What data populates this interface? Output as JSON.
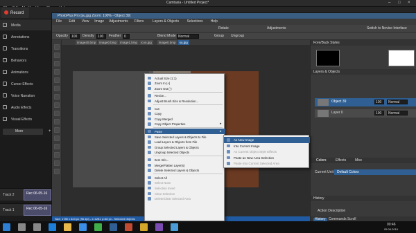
{
  "camtasia": {
    "menu": [
      "File",
      "Edit",
      "Modify",
      "View",
      "Share",
      "Help"
    ],
    "title": "Camtasia - Untitled Project*",
    "record_label": "Record",
    "sidebar": [
      {
        "label": "Media"
      },
      {
        "label": "Annotations"
      },
      {
        "label": "Transitions"
      },
      {
        "label": "Behaviors"
      },
      {
        "label": "Animations"
      },
      {
        "label": "Cursor Effects"
      },
      {
        "label": "Voice Narration"
      },
      {
        "label": "Audio Effects"
      },
      {
        "label": "Visual Effects"
      }
    ],
    "more_label": "More",
    "tracks": [
      {
        "label": "Track 2",
        "clip": "Rec 06-05-16"
      },
      {
        "label": "Track 1",
        "clip": "Rec 06-05-16"
      }
    ]
  },
  "ppp": {
    "title": "PhotoPlus Pro [su.jpg Zoom: 100% - Object 39]",
    "menu": [
      "File",
      "Edit",
      "View",
      "Image",
      "Adjustments",
      "Filters",
      "Layers & Objects",
      "Selections",
      "Help"
    ],
    "toolbar1": {
      "rotate": "Rotate",
      "adjustments": "Adjustments",
      "switch": "Switch to Novice Interface"
    },
    "toolbar2": {
      "opacity_label": "Opacity",
      "opacity": "100",
      "density_label": "Density",
      "density": "100",
      "feather_label": "Feather",
      "feather": "0",
      "blend_label": "Blend Mode",
      "blend": "Normal",
      "group": "Group",
      "ungroup": "Ungroup"
    },
    "tabs": [
      "image40.bmp",
      "image0.bmp",
      "image1.bmp",
      "icon.jpg",
      "image0.bmp",
      "su.jpg"
    ],
    "status": "Size: 1780 x 623 px (96 dpi) - x=1281 y=48 px - Selected Objects",
    "right": {
      "forebackstyles": "Fore/Back Styles",
      "layers": "Layers & Objects",
      "layer_rows": [
        {
          "name": "Object 39",
          "opacity": "100",
          "blend": "Normal"
        },
        {
          "name": "Layer 0",
          "opacity": "100",
          "blend": "Normal"
        }
      ],
      "tabs2": [
        "Colors",
        "Effects",
        "Misc"
      ],
      "current_unit_label": "Current Unit",
      "current_unit": "Default Colors",
      "history": "History",
      "action_description": "Action Description",
      "bottom_tabs": [
        "History",
        "Commands Scroll"
      ]
    }
  },
  "context_menu": [
    {
      "label": "Actual Size (1:1)"
    },
    {
      "label": "Zoom In (+)"
    },
    {
      "label": "Zoom Out (-)"
    },
    {
      "sep": true
    },
    {
      "label": "Resize..."
    },
    {
      "label": "Adjust Brush Size & Resolution..."
    },
    {
      "sep": true
    },
    {
      "label": "Cut"
    },
    {
      "label": "Copy"
    },
    {
      "label": "Copy Merged"
    },
    {
      "label": "Copy Object Properties"
    },
    {
      "sep": true
    },
    {
      "label": "Paste",
      "highlight": true
    },
    {
      "label": "Save Selected Layers & Objects to File"
    },
    {
      "label": "Load Layers & Objects from File"
    },
    {
      "label": "Group Selected Layers & Objects"
    },
    {
      "label": "Ungroup Selected Objects"
    },
    {
      "sep": true
    },
    {
      "label": "Item Info..."
    },
    {
      "label": "Merge/Flatten Layer(s)"
    },
    {
      "label": "Delete Selected Layers & Objects"
    },
    {
      "sep": true
    },
    {
      "label": "Select All"
    },
    {
      "label": "Select None",
      "disabled": true
    },
    {
      "label": "Selection Invert",
      "disabled": true
    },
    {
      "label": "Clear Selection",
      "disabled": true
    },
    {
      "label": "Delete/Clear Selected Area",
      "disabled": true
    }
  ],
  "paste_submenu": [
    {
      "label": "As New Image",
      "highlight": true
    },
    {
      "label": "Into Current Image"
    },
    {
      "label": "As Current Object Style Effects",
      "disabled": true
    },
    {
      "label": "Paste as New Area Selection"
    },
    {
      "label": "Paste Into Current Selected Area",
      "disabled": true
    }
  ],
  "taskbar": {
    "time": "00:46",
    "date": "05.06.2016"
  },
  "colors": {
    "accent": "#2f5f93",
    "record": "#e03b2f",
    "ppp_title": "#3a5d82"
  }
}
